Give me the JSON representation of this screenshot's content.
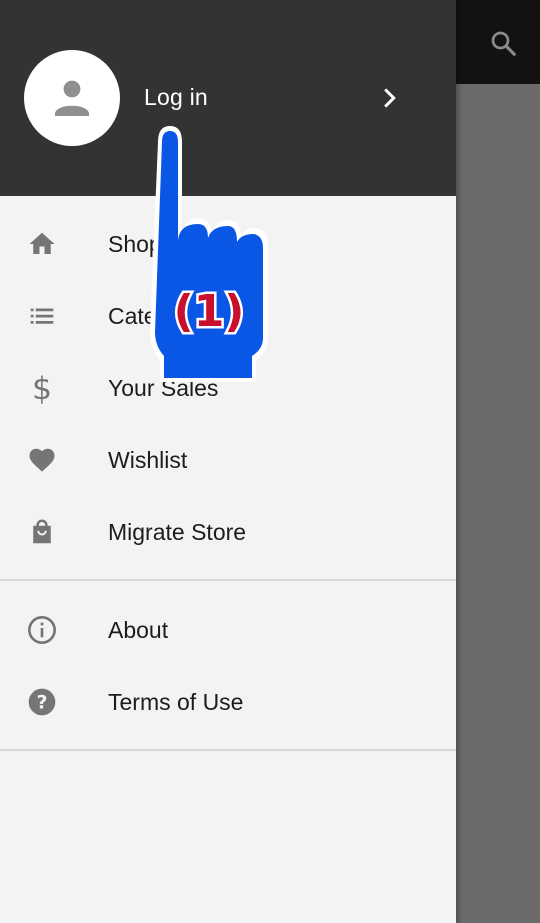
{
  "header": {
    "login_label": "Log in"
  },
  "menu": {
    "items": [
      {
        "label": "Shop",
        "icon": "home-icon"
      },
      {
        "label": "Categories",
        "icon": "list-icon"
      },
      {
        "label": "Your Sales",
        "icon": "dollar-icon"
      },
      {
        "label": "Wishlist",
        "icon": "heart-icon"
      },
      {
        "label": "Migrate Store",
        "icon": "bag-icon"
      }
    ],
    "secondary": [
      {
        "label": "About",
        "icon": "info-icon"
      },
      {
        "label": "Terms of Use",
        "icon": "help-icon"
      }
    ]
  },
  "overlay": {
    "step_label": "(1)"
  },
  "colors": {
    "header_bg": "#333333",
    "drawer_bg": "#f3f3f3",
    "hand_fill": "#0a57e6",
    "step_text": "#c8102e"
  }
}
